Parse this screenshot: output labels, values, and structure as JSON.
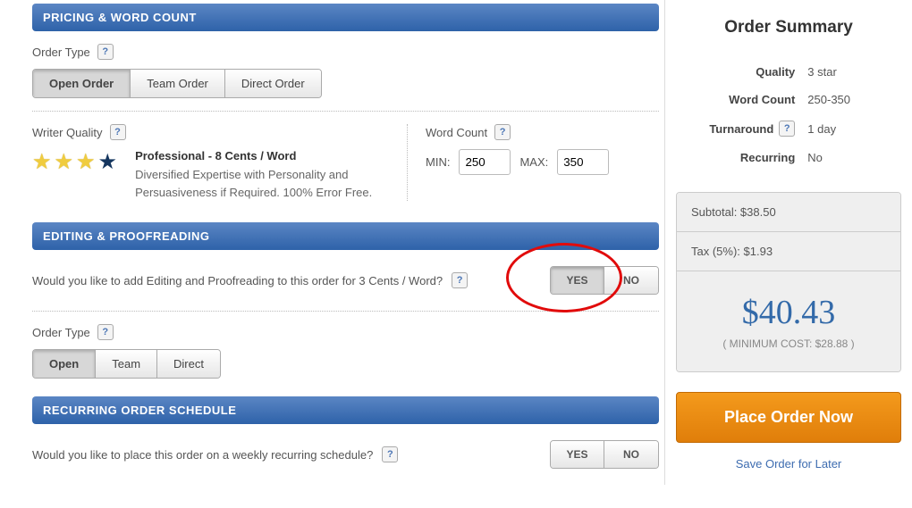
{
  "sections": {
    "pricing": "PRICING & WORD COUNT",
    "editing": "EDITING & PROOFREADING",
    "recurring": "RECURRING ORDER SCHEDULE"
  },
  "orderType": {
    "label": "Order Type",
    "options": {
      "open": "Open Order",
      "team": "Team Order",
      "direct": "Direct Order"
    }
  },
  "quality": {
    "label": "Writer Quality",
    "title": "Professional - 8 Cents / Word",
    "desc": "Diversified Expertise with Personality and Persuasiveness if Required. 100% Error Free."
  },
  "wordCount": {
    "label": "Word Count",
    "minLabel": "MIN:",
    "maxLabel": "MAX:",
    "min": "250",
    "max": "350"
  },
  "editing": {
    "prompt": "Would you like to add Editing and Proofreading to this order for 3 Cents / Word?",
    "yes": "YES",
    "no": "NO"
  },
  "editingOrderType": {
    "label": "Order Type",
    "options": {
      "open": "Open",
      "team": "Team",
      "direct": "Direct"
    }
  },
  "recurring": {
    "prompt": "Would you like to place this order on a weekly recurring schedule?",
    "yes": "YES",
    "no": "NO"
  },
  "summary": {
    "title": "Order Summary",
    "rows": {
      "qualityLabel": "Quality",
      "qualityValue": "3 star",
      "wcLabel": "Word Count",
      "wcValue": "250-350",
      "turnLabel": "Turnaround",
      "turnValue": "1 day",
      "recLabel": "Recurring",
      "recValue": "No"
    },
    "subtotal": "Subtotal: $38.50",
    "tax": "Tax (5%): $1.93",
    "total": "$40.43",
    "minCost": "( MINIMUM COST: $28.88 )",
    "placeOrder": "Place Order Now",
    "save": "Save Order for Later"
  }
}
